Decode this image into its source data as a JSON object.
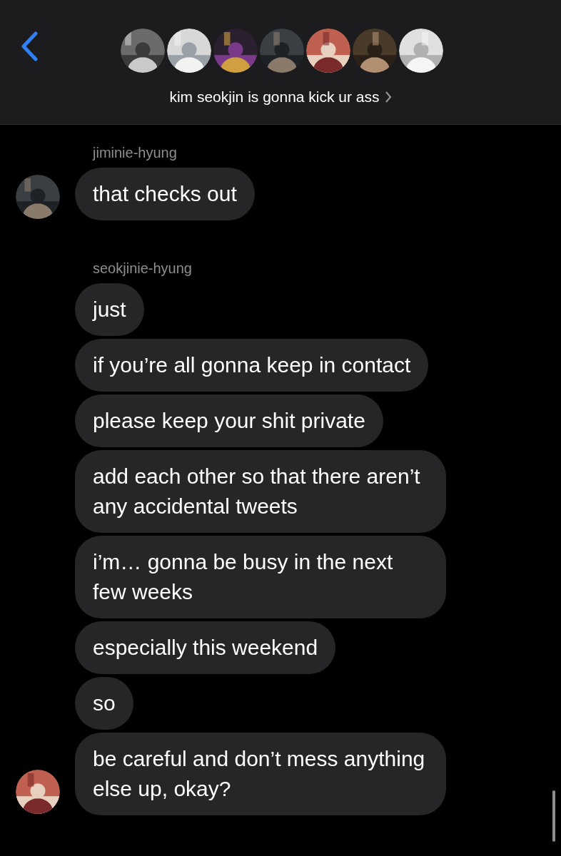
{
  "header": {
    "title": "kim seokjin is gonna kick ur ass",
    "avatars": [
      {
        "kind": "picture"
      },
      {
        "kind": "picture"
      },
      {
        "kind": "picture"
      },
      {
        "kind": "picture"
      },
      {
        "kind": "picture"
      },
      {
        "kind": "picture"
      },
      {
        "kind": "picture"
      }
    ]
  },
  "groups": [
    {
      "sender": "jiminie-hyung",
      "avatar": {
        "kind": "picture"
      },
      "messages": [
        "that checks out"
      ]
    },
    {
      "sender": "seokjinie-hyung",
      "avatar": {
        "kind": "picture"
      },
      "messages": [
        "just",
        "if you’re all gonna keep in contact",
        "please keep your shit private",
        "add each other so that there aren’t any accidental tweets",
        "i’m… gonna be busy in the next few weeks",
        "especially this weekend",
        "so",
        "be careful and don’t mess anything else up, okay?"
      ]
    }
  ]
}
